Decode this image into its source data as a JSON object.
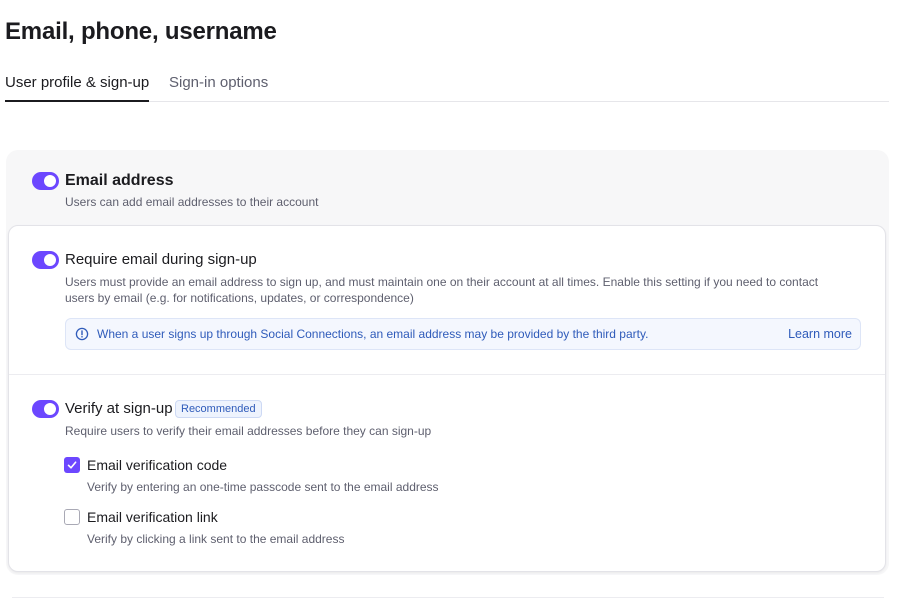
{
  "page": {
    "title": "Email, phone, username"
  },
  "tabs": [
    {
      "label": "User profile & sign-up",
      "active": true
    },
    {
      "label": "Sign-in options",
      "active": false
    }
  ],
  "email_address": {
    "label": "Email address",
    "description": "Users can add email addresses to their account",
    "enabled": true
  },
  "require_email": {
    "label": "Require email during sign-up",
    "description_line1": "Users must provide an email address to sign up, and must maintain one on their account at all times. Enable this setting if you need to contact",
    "description_line2": "users by email (e.g. for notifications, updates, or correspondence)",
    "enabled": true,
    "info": {
      "icon": "info-circle-icon",
      "text": "When a user signs up through Social Connections, an email address may be provided by the third party.",
      "link": "Learn more"
    }
  },
  "verify": {
    "label": "Verify at sign-up",
    "badge": "Recommended",
    "description": "Require users to verify their email addresses before they can sign-up",
    "enabled": true,
    "options": [
      {
        "label": "Email verification code",
        "description": "Verify by entering an one-time passcode sent to the email address",
        "checked": true
      },
      {
        "label": "Email verification link",
        "description": "Verify by clicking a link sent to the email address",
        "checked": false
      }
    ]
  },
  "colors": {
    "accent": "#6c47ff",
    "info_text": "#2f5bba",
    "info_bg": "#f4f7fe",
    "muted_text": "#5e5f6e"
  }
}
